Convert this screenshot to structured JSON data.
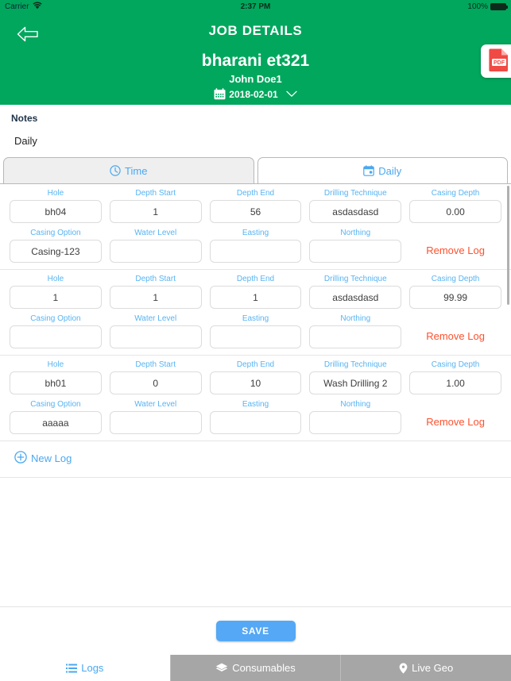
{
  "statusbar": {
    "carrier": "Carrier",
    "wifi_icon": "wifi-icon",
    "time": "2:37 PM",
    "battery_percent": "100%",
    "battery_icon": "battery-full-icon"
  },
  "header": {
    "back_icon": "back-arrow-icon",
    "title": "JOB DETAILS",
    "job_name": "bharani et321",
    "person": "John Doe1",
    "date": "2018-02-01",
    "calendar_icon": "calendar-icon",
    "chevron_icon": "chevron-down-icon",
    "pdf_icon": "pdf-file-icon",
    "accent_green": "#00a75d"
  },
  "notes": {
    "label": "Notes",
    "value": "Daily"
  },
  "tabs": {
    "items": [
      {
        "label": "Time",
        "icon": "clock-icon",
        "active": false
      },
      {
        "label": "Daily",
        "icon": "calendar-day-icon",
        "active": true
      }
    ]
  },
  "log_form": {
    "labels": {
      "hole": "Hole",
      "depth_start": "Depth Start",
      "depth_end": "Depth End",
      "drilling_technique": "Drilling Technique",
      "casing_depth": "Casing Depth",
      "casing_option": "Casing Option",
      "water_level": "Water Level",
      "easting": "Easting",
      "northing": "Northing"
    },
    "remove_label": "Remove Log",
    "new_log_label": "New Log",
    "new_log_icon": "plus-circle-icon",
    "placeholder": "",
    "rows": [
      {
        "hole": "bh04",
        "depth_start": "1",
        "depth_end": "56",
        "drilling_technique": "asdasdasd",
        "casing_depth": "0.00",
        "casing_option": "Casing-123",
        "water_level": "",
        "easting": "",
        "northing": ""
      },
      {
        "hole": "1",
        "depth_start": "1",
        "depth_end": "1",
        "drilling_technique": "asdasdasd",
        "casing_depth": "99.99",
        "casing_option": "",
        "water_level": "",
        "easting": "",
        "northing": ""
      },
      {
        "hole": "bh01",
        "depth_start": "0",
        "depth_end": "10",
        "drilling_technique": "Wash Drilling 2",
        "casing_depth": "1.00",
        "casing_option": "aaaaa",
        "water_level": "",
        "easting": "",
        "northing": ""
      }
    ]
  },
  "save": {
    "label": "SAVE",
    "color": "#54a8f5"
  },
  "tabbar": {
    "items": [
      {
        "label": "Logs",
        "icon": "list-icon",
        "selected": true
      },
      {
        "label": "Consumables",
        "icon": "diamond-layers-icon",
        "selected": false
      },
      {
        "label": "Live Geo",
        "icon": "map-pin-icon",
        "selected": false
      }
    ]
  },
  "colors": {
    "label_blue": "#57b4f2",
    "remove_red": "#fd512e",
    "header_green": "#00a75d"
  }
}
